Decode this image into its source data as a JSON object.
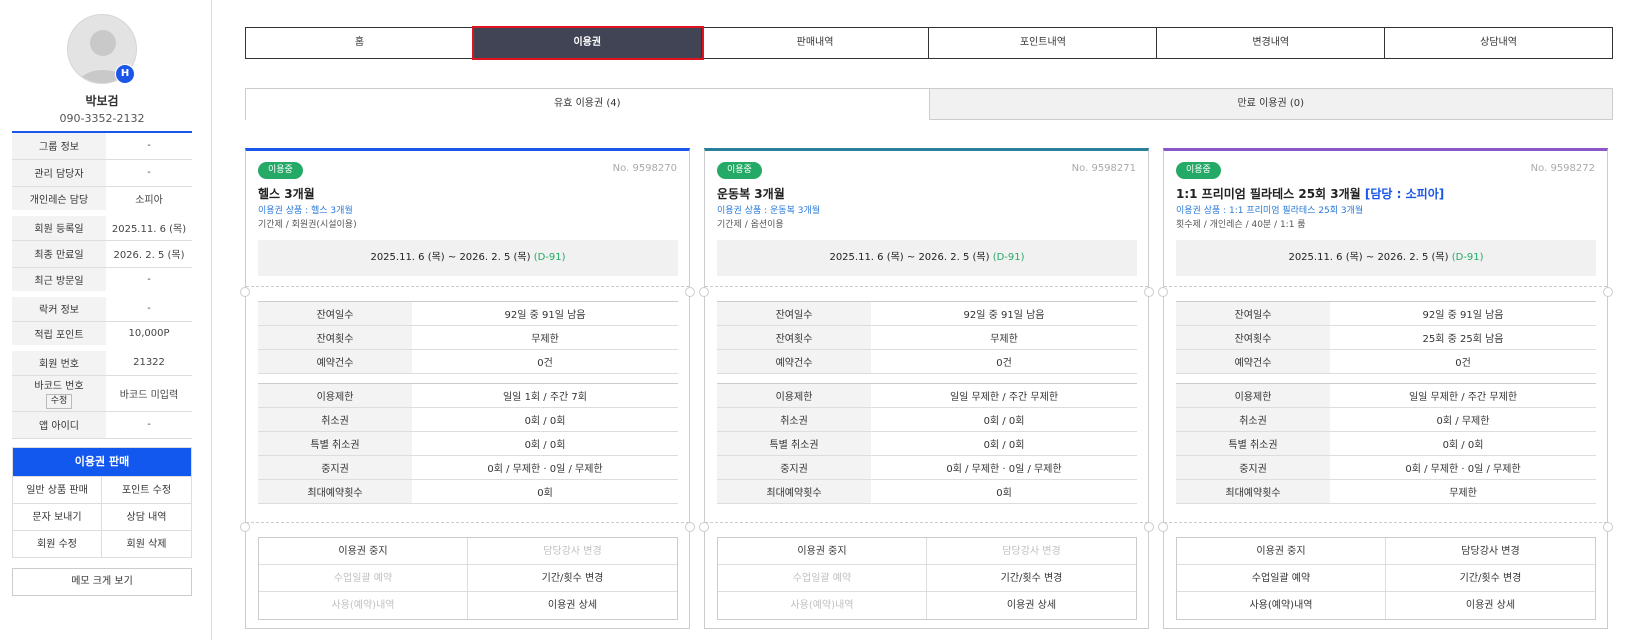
{
  "member": {
    "avatar_badge": "H",
    "name": "박보검",
    "phone": "090-3352-2132",
    "info": [
      {
        "label": "그룹 정보",
        "value": "-"
      },
      {
        "label": "관리 담당자",
        "value": "-"
      },
      {
        "label": "개인레슨 담당",
        "value": "소피아"
      },
      {
        "label": "회원 등록일",
        "value": "2025.11. 6 (목)"
      },
      {
        "label": "최종 만료일",
        "value": "2026. 2. 5 (목)"
      },
      {
        "label": "최근 방문일",
        "value": "-"
      },
      {
        "label": "락커 정보",
        "value": "-"
      },
      {
        "label": "적립 포인트",
        "value": "10,000P"
      },
      {
        "label": "회원 번호",
        "value": "21322"
      },
      {
        "label": "바코드 번호",
        "edit": "수정",
        "value": "바코드 미입력"
      },
      {
        "label": "앱 아이디",
        "value": "-"
      }
    ]
  },
  "sale": {
    "header": "이용권 판매",
    "buttons": [
      "일반 상품 판매",
      "포인트 수정",
      "문자 보내기",
      "상담 내역",
      "회원 수정",
      "회원 삭제"
    ]
  },
  "memo_button": "메모 크게 보기",
  "tabs": [
    "홈",
    "이용권",
    "판매내역",
    "포인트내역",
    "변경내역",
    "상담내역"
  ],
  "active_tab": "이용권",
  "subtabs": [
    "유효 이용권 (4)",
    "만료 이용권 (0)"
  ],
  "colors": {
    "accent": "#1a56e8",
    "active_tab_bg": "#404454",
    "highlight": "#e0141e",
    "status_green": "#25a966"
  },
  "cards": [
    {
      "status": "이용중",
      "number": "No. 9598270",
      "title": "헬스 3개월",
      "manager": "",
      "product": "이용권 상품 : 헬스 3개월",
      "type": "기간제 / 회원권(시설이용)",
      "period": "2025.11. 6 (목) ~ 2026. 2. 5 (목)",
      "dday": "(D-91)",
      "top_color": "#1a56e8",
      "usage": [
        {
          "label": "잔여일수",
          "value": "92일 중 91일 남음"
        },
        {
          "label": "잔여횟수",
          "value": "무제한"
        },
        {
          "label": "예약건수",
          "value": "0건"
        }
      ],
      "limits": [
        {
          "label": "이용제한",
          "value": "일일 1회 / 주간 7회"
        },
        {
          "label": "취소권",
          "value": "0회 / 0회"
        },
        {
          "label": "특별 취소권",
          "value": "0회 / 0회"
        },
        {
          "label": "중지권",
          "value": "0회 / 무제한 · 0일 / 무제한"
        },
        {
          "label": "최대예약횟수",
          "value": "0회"
        }
      ],
      "actions": [
        {
          "label": "이용권 중지",
          "enabled": true
        },
        {
          "label": "담당강사 변경",
          "enabled": false
        },
        {
          "label": "수업일괄 예약",
          "enabled": false
        },
        {
          "label": "기간/횟수 변경",
          "enabled": true
        },
        {
          "label": "사용(예약)내역",
          "enabled": false
        },
        {
          "label": "이용권 상세",
          "enabled": true
        }
      ]
    },
    {
      "status": "이용중",
      "number": "No. 9598271",
      "title": "운동복 3개월",
      "manager": "",
      "product": "이용권 상품 : 운동복 3개월",
      "type": "기간제 / 옵션이용",
      "period": "2025.11. 6 (목) ~ 2026. 2. 5 (목)",
      "dday": "(D-91)",
      "top_color": "#2a7f9a",
      "usage": [
        {
          "label": "잔여일수",
          "value": "92일 중 91일 남음"
        },
        {
          "label": "잔여횟수",
          "value": "무제한"
        },
        {
          "label": "예약건수",
          "value": "0건"
        }
      ],
      "limits": [
        {
          "label": "이용제한",
          "value": "일일 무제한 / 주간 무제한"
        },
        {
          "label": "취소권",
          "value": "0회 / 0회"
        },
        {
          "label": "특별 취소권",
          "value": "0회 / 0회"
        },
        {
          "label": "중지권",
          "value": "0회 / 무제한 · 0일 / 무제한"
        },
        {
          "label": "최대예약횟수",
          "value": "0회"
        }
      ],
      "actions": [
        {
          "label": "이용권 중지",
          "enabled": true
        },
        {
          "label": "담당강사 변경",
          "enabled": false
        },
        {
          "label": "수업일괄 예약",
          "enabled": false
        },
        {
          "label": "기간/횟수 변경",
          "enabled": true
        },
        {
          "label": "사용(예약)내역",
          "enabled": false
        },
        {
          "label": "이용권 상세",
          "enabled": true
        }
      ]
    },
    {
      "status": "이용중",
      "number": "No. 9598272",
      "title": "1:1 프리미엄 필라테스 25회 3개월",
      "manager": "[담당 : 소피아]",
      "product": "이용권 상품 : 1:1 프리미엄 필라테스 25회 3개월",
      "type": "횟수제 / 개인레슨 / 40분 / 1:1 룸",
      "period": "2025.11. 6 (목) ~ 2026. 2. 5 (목)",
      "dday": "(D-91)",
      "top_color": "#8a56c8",
      "usage": [
        {
          "label": "잔여일수",
          "value": "92일 중 91일 남음"
        },
        {
          "label": "잔여횟수",
          "value": "25회 중 25회 남음"
        },
        {
          "label": "예약건수",
          "value": "0건"
        }
      ],
      "limits": [
        {
          "label": "이용제한",
          "value": "일일 무제한 / 주간 무제한"
        },
        {
          "label": "취소권",
          "value": "0회 / 무제한"
        },
        {
          "label": "특별 취소권",
          "value": "0회 / 0회"
        },
        {
          "label": "중지권",
          "value": "0회 / 무제한 · 0일 / 무제한"
        },
        {
          "label": "최대예약횟수",
          "value": "무제한"
        }
      ],
      "actions": [
        {
          "label": "이용권 중지",
          "enabled": true
        },
        {
          "label": "담당강사 변경",
          "enabled": true
        },
        {
          "label": "수업일괄 예약",
          "enabled": true
        },
        {
          "label": "기간/횟수 변경",
          "enabled": true
        },
        {
          "label": "사용(예약)내역",
          "enabled": true
        },
        {
          "label": "이용권 상세",
          "enabled": true
        }
      ]
    }
  ]
}
